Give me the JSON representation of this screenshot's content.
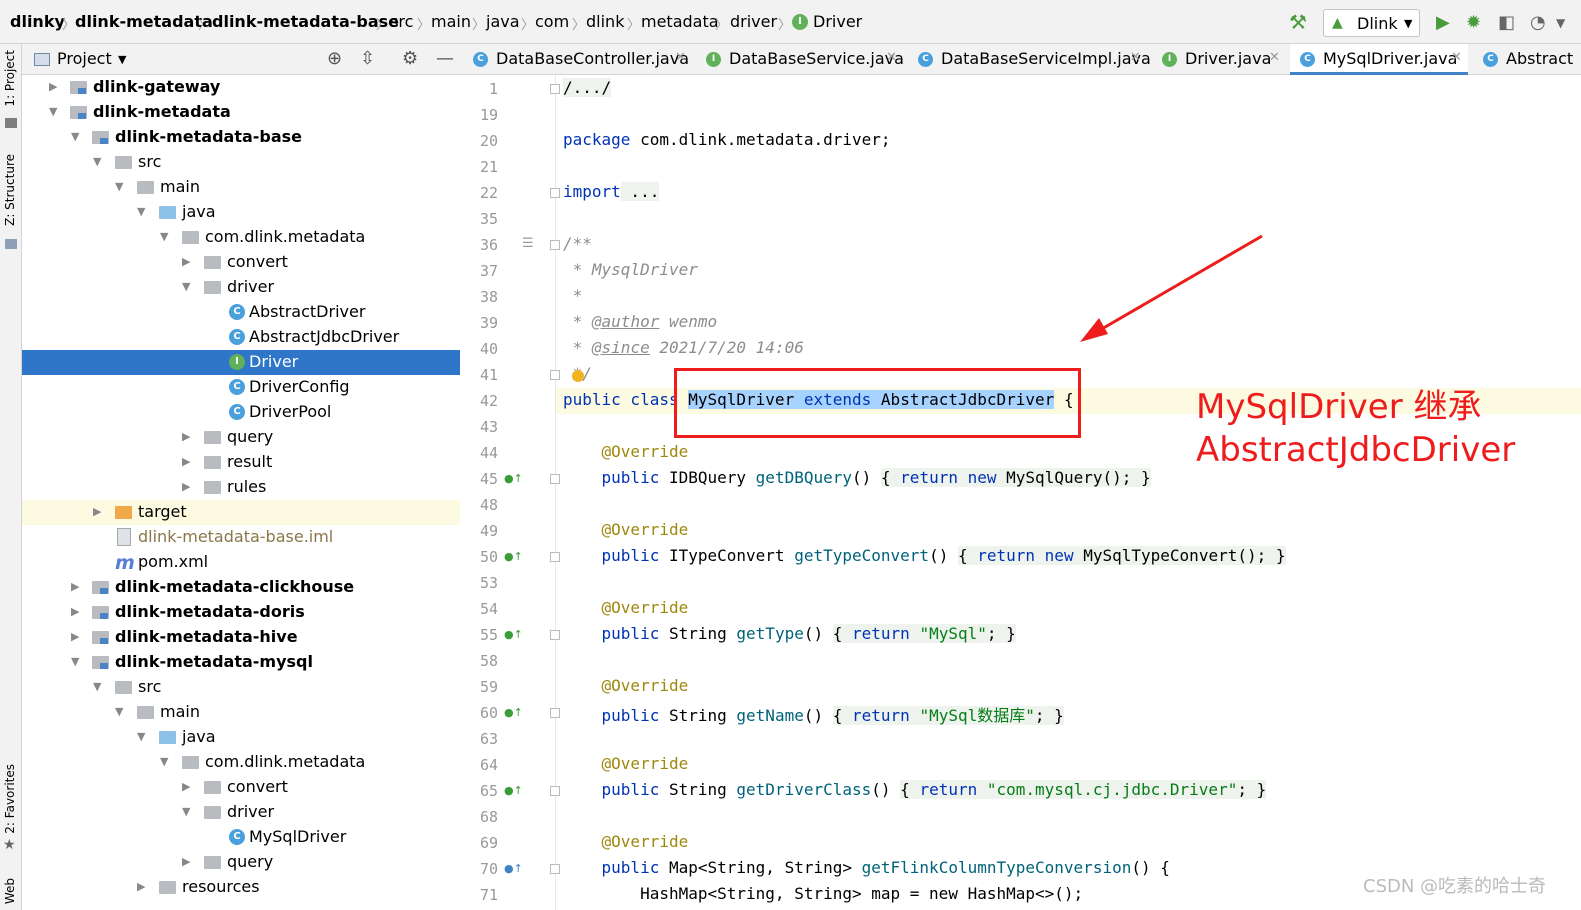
{
  "breadcrumb": [
    "dlinky",
    "dlink-metadata",
    "dlink-metadata-base",
    "src",
    "main",
    "java",
    "com",
    "dlink",
    "metadata",
    "driver",
    "Driver"
  ],
  "toolbar": {
    "run_config": "Dlink"
  },
  "left_strip": {
    "project_tab": "1: Project",
    "structure_tab": "Z: Structure",
    "favorites_tab": "2: Favorites",
    "web_tab": "Web"
  },
  "project_panel": {
    "title": "Project"
  },
  "tree": [
    {
      "label": "dlink-gateway"
    },
    {
      "label": "dlink-metadata"
    },
    {
      "label": "dlink-metadata-base"
    },
    {
      "label": "src"
    },
    {
      "label": "main"
    },
    {
      "label": "java"
    },
    {
      "label": "com.dlink.metadata"
    },
    {
      "label": "convert"
    },
    {
      "label": "driver"
    },
    {
      "label": "AbstractDriver"
    },
    {
      "label": "AbstractJdbcDriver"
    },
    {
      "label": "Driver"
    },
    {
      "label": "DriverConfig"
    },
    {
      "label": "DriverPool"
    },
    {
      "label": "query"
    },
    {
      "label": "result"
    },
    {
      "label": "rules"
    },
    {
      "label": "target"
    },
    {
      "label": "dlink-metadata-base.iml"
    },
    {
      "label": "pom.xml"
    },
    {
      "label": "dlink-metadata-clickhouse"
    },
    {
      "label": "dlink-metadata-doris"
    },
    {
      "label": "dlink-metadata-hive"
    },
    {
      "label": "dlink-metadata-mysql"
    },
    {
      "label": "src"
    },
    {
      "label": "main"
    },
    {
      "label": "java"
    },
    {
      "label": "com.dlink.metadata"
    },
    {
      "label": "convert"
    },
    {
      "label": "driver"
    },
    {
      "label": "MySqlDriver"
    },
    {
      "label": "query"
    },
    {
      "label": "resources"
    }
  ],
  "tabs": [
    {
      "label": "DataBaseController.java",
      "icon": "C"
    },
    {
      "label": "DataBaseService.java",
      "icon": "I"
    },
    {
      "label": "DataBaseServiceImpl.java",
      "icon": "C"
    },
    {
      "label": "Driver.java",
      "icon": "I"
    },
    {
      "label": "MySqlDriver.java",
      "icon": "C"
    },
    {
      "label": "Abstract",
      "icon": "C"
    }
  ],
  "line_numbers": [
    "1",
    "19",
    "20",
    "21",
    "22",
    "35",
    "36",
    "37",
    "38",
    "39",
    "40",
    "41",
    "42",
    "43",
    "44",
    "45",
    "48",
    "49",
    "50",
    "53",
    "54",
    "55",
    "58",
    "59",
    "60",
    "63",
    "64",
    "65",
    "68",
    "69",
    "70",
    "71"
  ],
  "code": {
    "l1": "/.../",
    "l20_kw": "package",
    "l20_rest": " com.dlink.metadata.driver;",
    "l22_kw": "import",
    "l22_rest": " ...",
    "l36": "/**",
    "l37": " * MysqlDriver",
    "l38": " *",
    "l39_a": " * ",
    "l39_tag": "@author",
    "l39_b": " wenmo",
    "l40_a": " * ",
    "l40_tag": "@since",
    "l40_b": " 2021/7/20 14:06",
    "l41": " */",
    "l42_kw": "public class ",
    "l42_name": "MySqlDriver",
    "l42_ext": "extends",
    "l42_super": "AbstractJdbcDriver",
    "l42_brace": " {",
    "override": "@Override",
    "m1_type": "IDBQuery ",
    "m1_name": "getDBQuery",
    "m1_body": "MySqlQuery();",
    "m2_type": "ITypeConvert ",
    "m2_name": "getTypeConvert",
    "m2_body": "MySqlTypeConvert();",
    "m3_type": "String ",
    "m3_name": "getType",
    "m3_str": "\"MySql\"",
    "m4_type": "String ",
    "m4_name": "getName",
    "m4_str": "\"MySql数据库\"",
    "m5_type": "String ",
    "m5_name": "getDriverClass",
    "m5_str": "\"com.mysql.cj.jdbc.Driver\"",
    "m6_type": "Map<String, String> ",
    "m6_name": "getFlinkColumnTypeConversion",
    "m6_tail": "() {",
    "l71": "        HashMap<String, String> map = new HashMap<>();",
    "kw_public": "public",
    "kw_return": "return",
    "kw_new": "new"
  },
  "annotation": {
    "line1": "MySqlDriver 继承",
    "line2": "AbstractJdbcDriver",
    "color": "#ee1c1c"
  },
  "watermark": "CSDN @吃素的哈士奇"
}
